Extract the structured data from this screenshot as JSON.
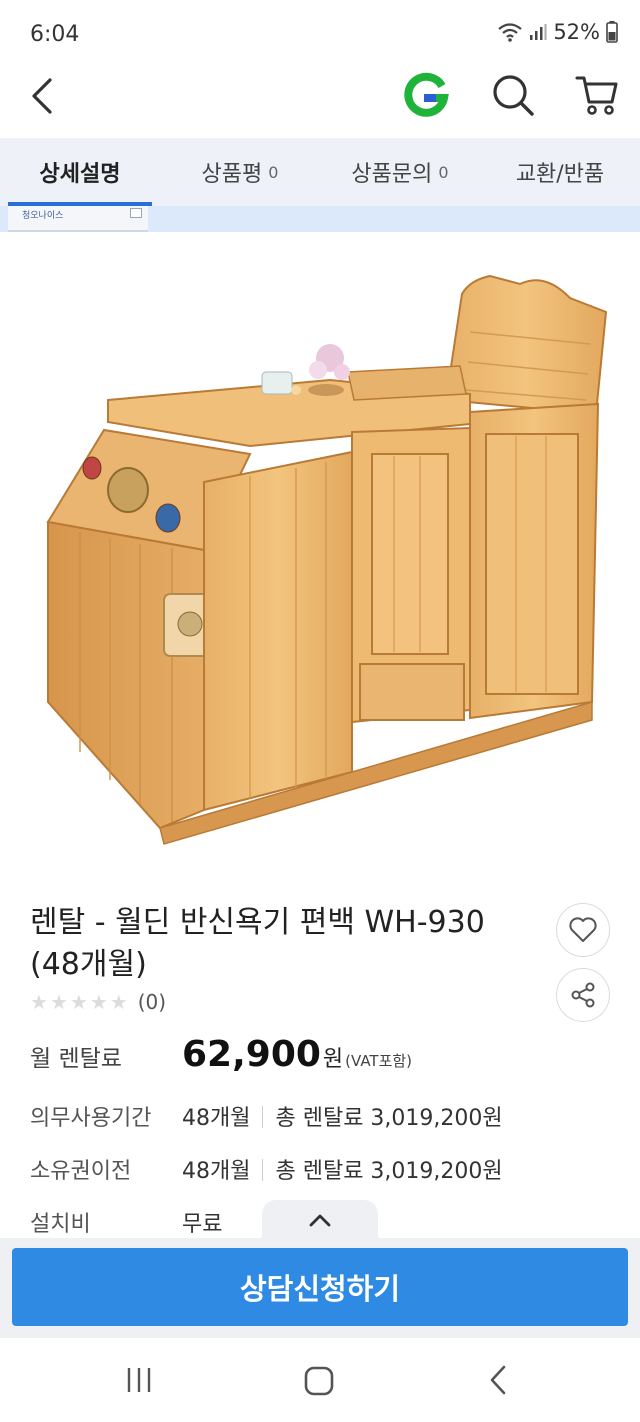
{
  "status_bar": {
    "time": "6:04",
    "battery": "52%"
  },
  "tabs": [
    {
      "label": "상세설명",
      "count": ""
    },
    {
      "label": "상품평",
      "count": "0"
    },
    {
      "label": "상품문의",
      "count": "0"
    },
    {
      "label": "교환/반품",
      "count": ""
    }
  ],
  "banner": {
    "brand": "청오나이스"
  },
  "product": {
    "title_line1": "렌탈 - 월딘 반신욕기 편백 WH-930",
    "title_line2": "(48개월)",
    "rating_count": "(0)",
    "rating_value": 0
  },
  "price": {
    "label": "월 렌탈료",
    "amount": "62,900",
    "won": "원",
    "vat": "(VAT포함)"
  },
  "details": [
    {
      "label": "의무사용기간",
      "period": "48개월",
      "total": "총 렌탈료 3,019,200원"
    },
    {
      "label": "소유권이전",
      "period": "48개월",
      "total": "총 렌탈료 3,019,200원"
    },
    {
      "label": "설치비",
      "period": "무료",
      "total": ""
    }
  ],
  "cta": {
    "label": "상담신청하기"
  },
  "colors": {
    "accent": "#2f8ae4",
    "tab_indicator": "#2a6fd6",
    "gmarket_green": "#1fb339",
    "gmarket_blue": "#2a5fd6"
  },
  "icons": [
    "back-arrow-icon",
    "gmarket-logo-icon",
    "search-icon",
    "cart-icon",
    "heart-icon",
    "share-icon",
    "chevron-up-icon",
    "recent-apps-icon",
    "home-icon",
    "system-back-icon"
  ]
}
